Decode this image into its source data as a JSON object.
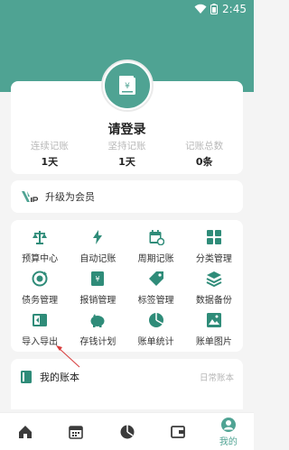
{
  "status_bar": {
    "time": "2:45"
  },
  "profile": {
    "title": "请登录",
    "stats": [
      {
        "label": "连续记账",
        "value": "1天"
      },
      {
        "label": "坚持记账",
        "value": "1天"
      },
      {
        "label": "记账总数",
        "value": "0条"
      }
    ]
  },
  "vip": {
    "label": "升级为会员"
  },
  "tools": [
    {
      "label": "预算中心",
      "icon": "scale-icon"
    },
    {
      "label": "自动记账",
      "icon": "lightning-icon"
    },
    {
      "label": "周期记账",
      "icon": "calendar-cycle-icon"
    },
    {
      "label": "分类管理",
      "icon": "grid-icon"
    },
    {
      "label": "债务管理",
      "icon": "debt-icon"
    },
    {
      "label": "报销管理",
      "icon": "reimburse-icon"
    },
    {
      "label": "标签管理",
      "icon": "tag-icon"
    },
    {
      "label": "数据备份",
      "icon": "layers-icon"
    },
    {
      "label": "导入导出",
      "icon": "import-export-icon"
    },
    {
      "label": "存钱计划",
      "icon": "piggy-bank-icon"
    },
    {
      "label": "账单统计",
      "icon": "pie-chart-icon"
    },
    {
      "label": "账单图片",
      "icon": "image-icon"
    }
  ],
  "books": {
    "label": "我的账本",
    "current": "日常账本"
  },
  "tabs": [
    {
      "label": "",
      "icon": "home-icon"
    },
    {
      "label": "",
      "icon": "calendar-icon"
    },
    {
      "label": "",
      "icon": "pie-chart-icon"
    },
    {
      "label": "",
      "icon": "wallet-icon"
    },
    {
      "label": "我的",
      "icon": "person-icon"
    }
  ],
  "colors": {
    "accent": "#4fa393",
    "background": "#f4f4f4"
  }
}
